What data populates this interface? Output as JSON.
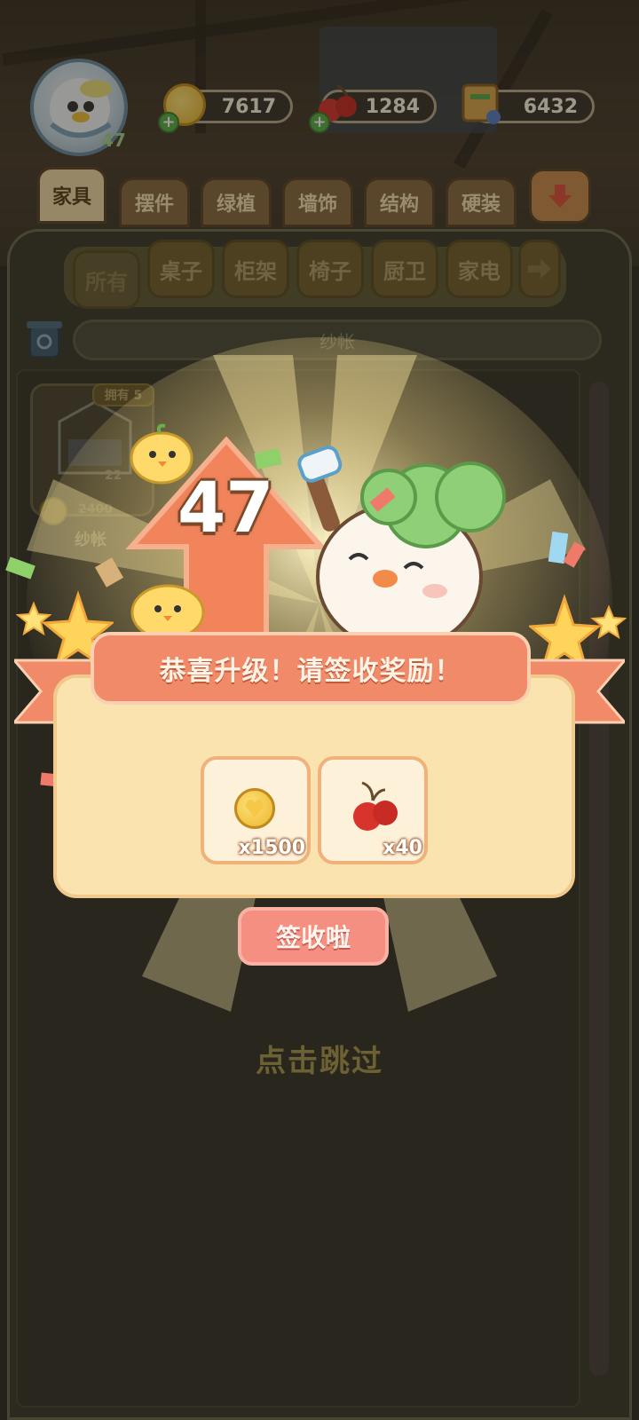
{
  "hud": {
    "avatar_level": "47",
    "coins": "7617",
    "cherries": "1284",
    "books": "6432"
  },
  "category_tabs": [
    "家具",
    "摆件",
    "绿植",
    "墙饰",
    "结构",
    "硬装"
  ],
  "sub_tabs": [
    "所有",
    "桌子",
    "柜架",
    "椅子",
    "厨卫",
    "家电"
  ],
  "search": {
    "value": "纱帐"
  },
  "item": {
    "owned_badge": "拥有 5",
    "count": "22",
    "price": "2400",
    "name": "纱帐"
  },
  "level_up": {
    "level": "47",
    "banner": "恭喜升级！请签收奖励！",
    "rewards": [
      {
        "icon": "gold-coin-icon",
        "qty": "x1500"
      },
      {
        "icon": "cherry-icon",
        "qty": "x40"
      }
    ],
    "claim_button": "签收啦",
    "skip_text": "点击跳过"
  },
  "colors": {
    "banner": "#f08a68",
    "claim_button": "#f58f82",
    "card": "#fbe3b0",
    "accent_green": "#a7d08a"
  }
}
